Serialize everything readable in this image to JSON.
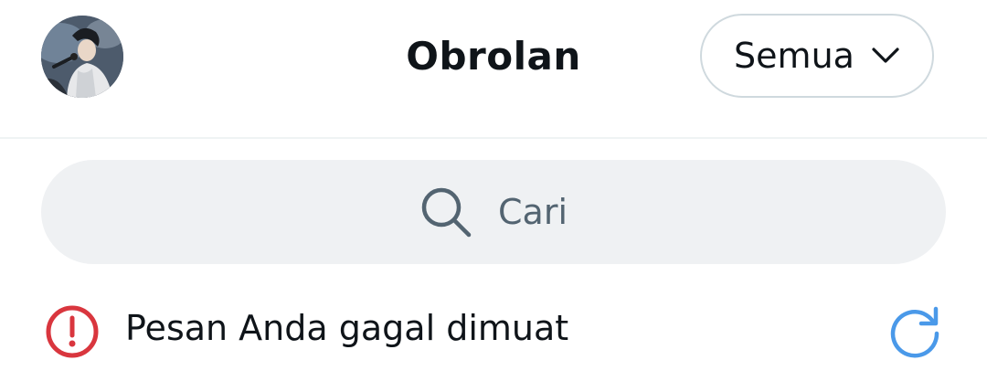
{
  "header": {
    "title": "Obrolan",
    "avatar_icon": "user-avatar",
    "filter": {
      "label": "Semua",
      "icon": "chevron-down-icon"
    }
  },
  "search": {
    "placeholder": "Cari",
    "icon": "search-icon"
  },
  "error": {
    "message": "Pesan Anda gagal dimuat",
    "icon": "error-icon",
    "retry_icon": "refresh-icon",
    "error_color": "#d9363e",
    "accent_color": "#4a99e9"
  }
}
